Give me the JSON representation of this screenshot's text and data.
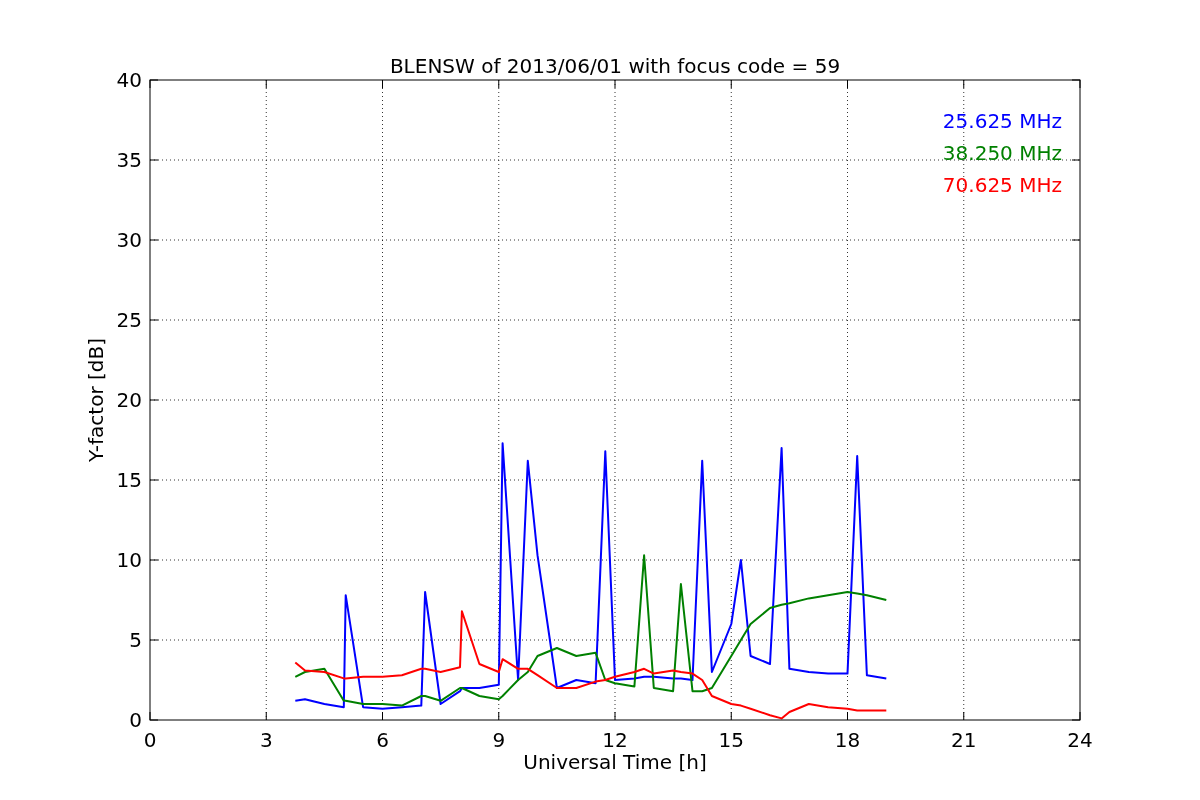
{
  "chart_data": {
    "type": "line",
    "title": "BLENSW of 2013/06/01 with focus code = 59",
    "xlabel": "Universal Time [h]",
    "ylabel": "Y-factor [dB]",
    "x": [
      3.75,
      4,
      4.5,
      5,
      5.05,
      5.5,
      6,
      6.5,
      7,
      7.1,
      7.5,
      8,
      8.05,
      8.5,
      9,
      9.1,
      9.5,
      9.75,
      10,
      10.5,
      11,
      11.5,
      11.75,
      12,
      12.5,
      12.75,
      13,
      13.5,
      13.7,
      14,
      14.25,
      14.5,
      15,
      15.25,
      15.5,
      16,
      16.3,
      16.5,
      17,
      17.5,
      18,
      18.25,
      18.5,
      19
    ],
    "series": [
      {
        "name": "25.625 MHz",
        "color": "#0000ff",
        "values": [
          1.2,
          1.3,
          1.0,
          0.8,
          7.8,
          0.8,
          0.7,
          0.8,
          0.9,
          8.0,
          1.0,
          1.8,
          2.0,
          2.0,
          2.2,
          17.3,
          2.5,
          16.2,
          10.3,
          2.0,
          2.5,
          2.3,
          16.8,
          2.5,
          2.6,
          2.7,
          2.7,
          2.6,
          2.6,
          2.5,
          16.2,
          3.0,
          6.0,
          10.0,
          4.0,
          3.5,
          17.0,
          3.2,
          3.0,
          2.9,
          2.9,
          16.5,
          2.8,
          2.6
        ]
      },
      {
        "name": "38.250 MHz",
        "color": "#008000",
        "values": [
          2.7,
          3.0,
          3.2,
          1.2,
          1.2,
          1.0,
          1.0,
          0.9,
          1.5,
          1.5,
          1.2,
          2.0,
          2.0,
          1.5,
          1.3,
          1.5,
          2.5,
          3.0,
          4.0,
          4.5,
          4.0,
          4.2,
          2.5,
          2.3,
          2.1,
          10.3,
          2.0,
          1.8,
          8.5,
          1.8,
          1.8,
          2.0,
          4.0,
          5.0,
          6.0,
          7.0,
          7.2,
          7.3,
          7.6,
          7.8,
          8.0,
          7.9,
          7.8,
          7.5
        ]
      },
      {
        "name": "70.625 MHz",
        "color": "#ff0000",
        "values": [
          3.6,
          3.1,
          3.0,
          2.6,
          2.6,
          2.7,
          2.7,
          2.8,
          3.2,
          3.2,
          3.0,
          3.3,
          6.8,
          3.5,
          3.0,
          3.8,
          3.2,
          3.2,
          2.8,
          2.0,
          2.0,
          2.4,
          2.5,
          2.7,
          3.0,
          3.2,
          2.9,
          3.1,
          3.0,
          2.9,
          2.5,
          1.5,
          1.0,
          0.9,
          0.7,
          0.3,
          0.1,
          0.5,
          1.0,
          0.8,
          0.7,
          0.6,
          0.6,
          0.6
        ]
      }
    ],
    "xlim": [
      0,
      24
    ],
    "ylim": [
      0,
      40
    ],
    "xticks": [
      0,
      3,
      6,
      9,
      12,
      15,
      18,
      21,
      24
    ],
    "yticks": [
      0,
      5,
      10,
      15,
      20,
      25,
      30,
      35,
      40
    ],
    "grid": true
  }
}
